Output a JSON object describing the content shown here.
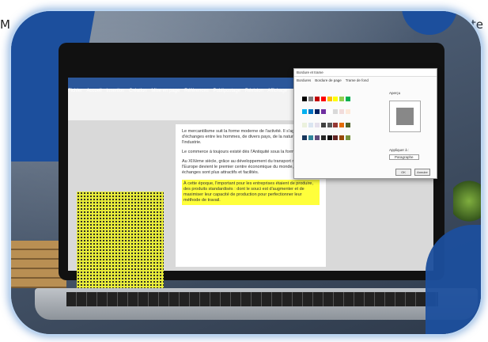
{
  "header": {
    "left_char": "M",
    "right_char": "te"
  },
  "word": {
    "tabs": [
      "Fichier",
      "Accueil",
      "Insertion",
      "Création",
      "Mise en page",
      "Références",
      "Publipostage",
      "Révision",
      "Affichage"
    ],
    "paragraphs": [
      "Le mercantilisme suit la forme moderne de l'activité. Il s'agit d'échanges entre les hommes, de divers pays, de la nature ou de l'industrie.",
      "Le commerce à toujours existé dès l'Antiquité sous la forme du troc.",
      "Au XIXème siècle, grâce au développement du transport maritime, l'Europe devient le premier centre économique du monde, de ce fait les échanges sont plus attractifs et facilités."
    ],
    "highlighted": "À cette époque, l'important pour les entreprises étaient de produire, des produits standardisés : dont le souci est d'augmenter et de maximiser leur capacité de production pour perfectionner leur méthode de travail."
  },
  "dialog": {
    "title": "Bordure et trame",
    "tabs": [
      "Bordures",
      "Bordure de page",
      "Trame de fond"
    ],
    "preview_label": "Aperçu",
    "apply_label": "Appliquer à :",
    "apply_value": "Paragraphe",
    "ok_label": "OK",
    "cancel_label": "Annuler"
  },
  "colors": {
    "accent": "#1c4f9d",
    "word_blue": "#2b579a",
    "highlight": "#ffff3b",
    "swatches": [
      "#000000",
      "#7f7f7f",
      "#c00000",
      "#ff0000",
      "#ffc000",
      "#ffff00",
      "#92d050",
      "#00b050",
      "#00b0f0",
      "#0070c0",
      "#002060",
      "#7030a0",
      "#ffffff",
      "#d9d9d9",
      "#f2dcdb",
      "#fde9d9",
      "#ebf1dd",
      "#dbe5f1",
      "#e5e0ec",
      "#404040",
      "#595959",
      "#953734",
      "#e36c09",
      "#4f6228",
      "#17365d",
      "#31859b",
      "#5f497a",
      "#262626",
      "#0d0d0d",
      "#632423",
      "#974806",
      "#76923c"
    ]
  }
}
